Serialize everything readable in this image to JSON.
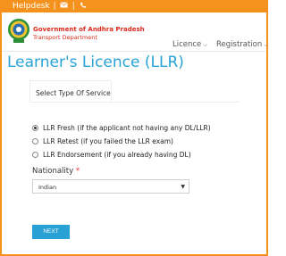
{
  "topbar": {
    "helpdesk_label": "Helpdesk",
    "separator": "|",
    "mail_icon": "mail-icon",
    "phone_icon": "phone-icon"
  },
  "header": {
    "org_title": "Government of Andhra Pradesh",
    "org_subtitle": "Transport Department",
    "nav": [
      {
        "label": "Licence"
      },
      {
        "label": "Registration"
      }
    ]
  },
  "page": {
    "title": "Learner's Licence (LLR)"
  },
  "form": {
    "tab_label": "Select Type Of Service",
    "options": [
      {
        "label": "LLR Fresh (if the applicant not having any DL/LLR)",
        "selected": true
      },
      {
        "label": "LLR Retest (if you failed the LLR exam)",
        "selected": false
      },
      {
        "label": "LLR Endorsement (if you already having DL)",
        "selected": false
      }
    ],
    "nationality_label": "Nationality",
    "required_marker": "*",
    "nationality_value": "Indian",
    "next_label": "NEXT"
  },
  "colors": {
    "accent_orange": "#f5921e",
    "title_blue": "#29a3d6",
    "brand_red": "#d9291c",
    "button_blue": "#2aa1d4"
  }
}
